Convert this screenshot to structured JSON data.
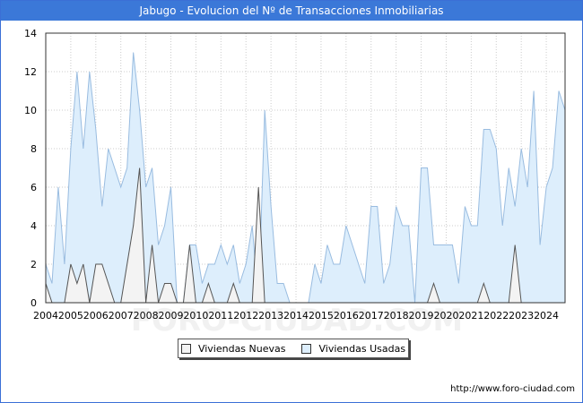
{
  "title": "Jabugo - Evolucion del Nº de Transacciones Inmobiliarias",
  "footer_url": "http://www.foro-ciudad.com",
  "watermark": "FORO-CIUDAD.COM",
  "chart_data": {
    "type": "area",
    "title": "Jabugo - Evolucion del Nº de Transacciones Inmobiliarias",
    "xlabel": "",
    "ylabel": "",
    "ylim": [
      0,
      14
    ],
    "yticks": [
      0,
      2,
      4,
      6,
      8,
      10,
      12,
      14
    ],
    "xlim": [
      2004,
      2024.75
    ],
    "xticks": [
      2004,
      2005,
      2006,
      2007,
      2008,
      2009,
      2010,
      2011,
      2012,
      2013,
      2014,
      2015,
      2016,
      2017,
      2018,
      2019,
      2020,
      2021,
      2022,
      2023,
      2024
    ],
    "grid": true,
    "legend_position": "bottom",
    "colors": {
      "nuevas_fill": "#f3f3f3",
      "nuevas_line": "#555555",
      "usadas_fill": "#ddeefc",
      "usadas_line": "#99bce0"
    },
    "series": [
      {
        "name": "Viviendas Nuevas",
        "values": [
          1,
          0,
          0,
          0,
          2,
          1,
          2,
          0,
          2,
          2,
          1,
          0,
          0,
          2,
          4,
          7,
          0,
          3,
          0,
          1,
          1,
          0,
          0,
          3,
          0,
          0,
          1,
          0,
          0,
          0,
          1,
          0,
          0,
          0,
          6,
          0,
          0,
          0,
          0,
          0,
          0,
          0,
          0,
          0,
          0,
          0,
          0,
          0,
          0,
          0,
          0,
          0,
          0,
          0,
          0,
          0,
          0,
          0,
          0,
          0,
          0,
          0,
          1,
          0,
          0,
          0,
          0,
          0,
          0,
          0,
          1,
          0,
          0,
          0,
          0,
          3,
          0,
          0,
          0,
          0,
          0,
          0,
          0,
          0
        ]
      },
      {
        "name": "Viviendas Usadas",
        "values": [
          2,
          1,
          6,
          2,
          8,
          12,
          8,
          12,
          9,
          5,
          8,
          7,
          6,
          7,
          13,
          10,
          6,
          7,
          3,
          4,
          6,
          0,
          0,
          3,
          3,
          1,
          2,
          2,
          3,
          2,
          3,
          1,
          2,
          4,
          0,
          10,
          5,
          1,
          1,
          0,
          0,
          0,
          0,
          2,
          1,
          3,
          2,
          2,
          4,
          3,
          2,
          1,
          5,
          5,
          1,
          2,
          5,
          4,
          4,
          0,
          7,
          7,
          3,
          3,
          3,
          3,
          1,
          5,
          4,
          4,
          9,
          9,
          8,
          4,
          7,
          5,
          8,
          6,
          11,
          3,
          6,
          7,
          11,
          10
        ]
      }
    ]
  },
  "legend": {
    "items": [
      {
        "label": "Viviendas Nuevas"
      },
      {
        "label": "Viviendas Usadas"
      }
    ]
  }
}
